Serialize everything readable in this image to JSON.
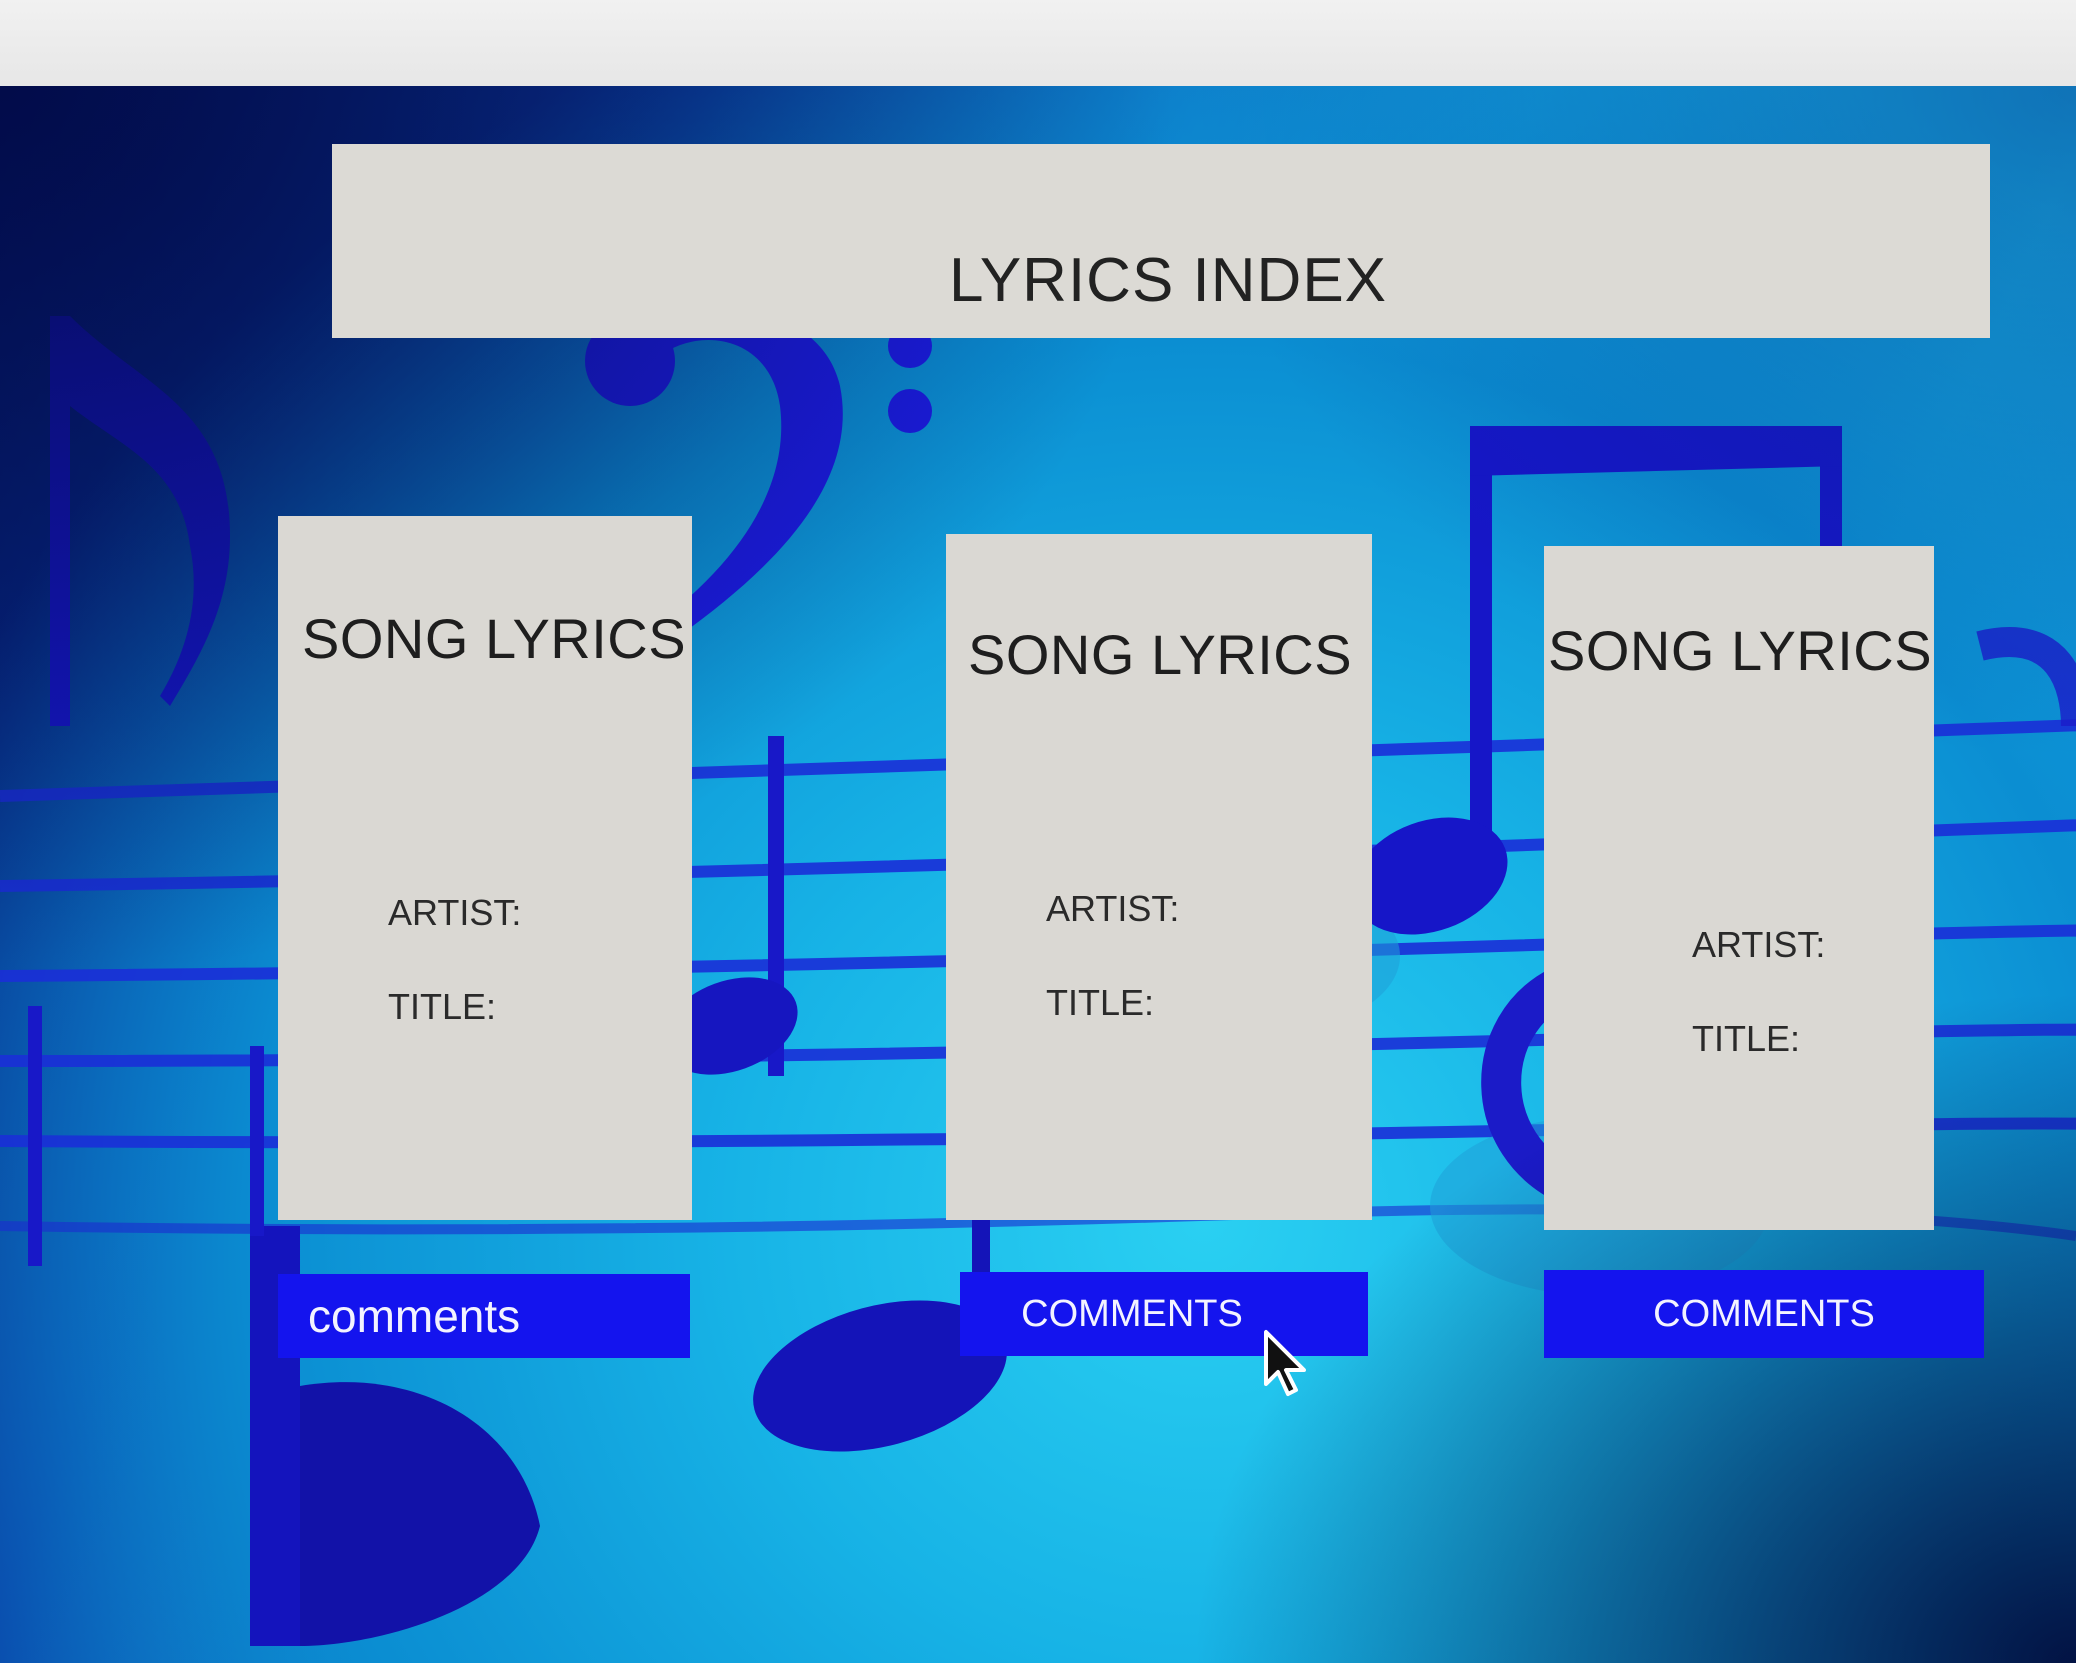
{
  "header": {
    "title": "LYRICS INDEX"
  },
  "cards": [
    {
      "title": "SONG LYRICS",
      "artist_label": "ARTIST:",
      "title_label": "TITLE:",
      "comments_label": "comments"
    },
    {
      "title": "SONG LYRICS",
      "artist_label": "ARTIST:",
      "title_label": "TITLE:",
      "comments_label": "COMMENTS"
    },
    {
      "title": "SONG LYRICS",
      "artist_label": "ARTIST:",
      "title_label": "TITLE:",
      "comments_label": "COMMENTS"
    }
  ],
  "colors": {
    "button": "#1414ee",
    "panel": "#dad8d3",
    "background": "#12a6e2"
  },
  "icons": {
    "background": "music-notes-background",
    "cursor": "mouse-pointer-icon"
  }
}
